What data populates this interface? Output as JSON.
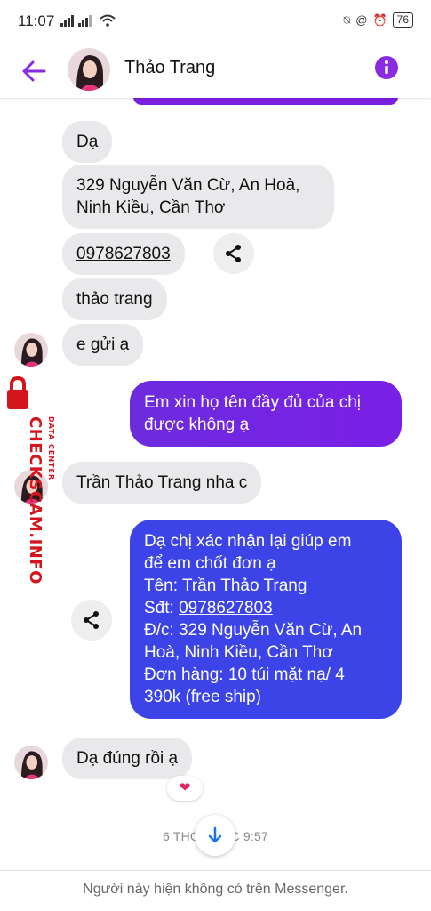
{
  "status_bar": {
    "time": "11:07",
    "battery": "76"
  },
  "header": {
    "contact_name": "Thảo Trang"
  },
  "messages": [
    {
      "dir": "in",
      "text": "Dạ"
    },
    {
      "dir": "in",
      "lines": [
        "329 Nguyễn Văn Cừ, An Hoà,",
        "Ninh Kiều, Cần Thơ"
      ]
    },
    {
      "dir": "in",
      "text": "0978627803"
    },
    {
      "dir": "in",
      "text": "thảo trang"
    },
    {
      "dir": "in",
      "text": "e gửi ạ"
    },
    {
      "dir": "out",
      "lines": [
        "Em xin họ tên đầy đủ của chị",
        "được không ạ"
      ]
    },
    {
      "dir": "in",
      "text": "Trần Thảo Trang nha c"
    },
    {
      "dir": "out",
      "lines": [
        "Dạ chị xác nhận lại giúp em",
        "để em chốt đơn ạ",
        "Tên: Trần Thảo Trang"
      ],
      "phone_prefix": "Sđt: ",
      "phone": "0978627803",
      "lines2": [
        "Đ/c: 329 Nguyễn Văn Cừ, An",
        "Hoà, Ninh Kiều, Cần Thơ",
        "Đơn hàng: 10 túi mặt nạ/ 4",
        "390k (free ship)"
      ]
    },
    {
      "dir": "in",
      "text": "Dạ đúng rồi ạ",
      "reaction": "❤"
    }
  ],
  "timestamp": "6 THG 9 LÚC 9:57",
  "footer": {
    "text": "Người này hiện không có trên Messenger."
  },
  "watermark": {
    "brand": "CHECKSCAM.INFO",
    "tagline": "DATA CENTER"
  },
  "colors": {
    "accent": "#8a2be2",
    "outgoing_purple": "#7a1fe6",
    "outgoing_blue": "#3c44e8",
    "incoming": "#e9e9eb"
  },
  "icons": {
    "back": "arrow-left-icon",
    "info": "info-icon",
    "share": "share-icon",
    "scroll": "arrow-down-icon"
  }
}
